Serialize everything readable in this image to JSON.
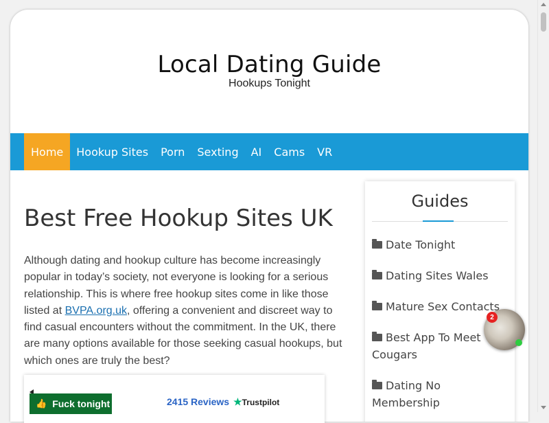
{
  "header": {
    "site_title": "Local Dating Guide",
    "tagline": "Hookups Tonight"
  },
  "nav": {
    "items": [
      {
        "label": "Home",
        "active": true
      },
      {
        "label": "Hookup Sites"
      },
      {
        "label": "Porn"
      },
      {
        "label": "Sexting"
      },
      {
        "label": "AI"
      },
      {
        "label": "Cams"
      },
      {
        "label": "VR"
      }
    ]
  },
  "article": {
    "title": "Best Free Hookup Sites UK",
    "para_before_link": "Although dating and hookup culture has become increasingly popular in today’s society, not everyone is looking for a serious relationship. This is where free hookup sites come in like those listed at ",
    "link_text": "BVPA.org.uk",
    "para_after_link": ", offering a convenient and discreet way to find casual encounters without the commitment. In the UK, there are many options available for those seeking casual hookups, but which ones are truly the best?"
  },
  "reviews": {
    "count_text": "2415 Reviews",
    "brand": "Trustpilot"
  },
  "sidebar": {
    "title": "Guides",
    "items": [
      {
        "label": "Date Tonight"
      },
      {
        "label": "Dating Sites Wales"
      },
      {
        "label": "Mature Sex Contacts"
      },
      {
        "label": "Best App To Meet Cougars"
      },
      {
        "label": "Dating No Membership"
      }
    ]
  },
  "cta": {
    "label": "Fuck tonight",
    "icon": "thumbs-up-icon"
  },
  "chat_bubble": {
    "badge_count": "2"
  },
  "colors": {
    "nav_bg": "#1a9ad6",
    "nav_active": "#f5a623",
    "cta_bg": "#0e6e2e",
    "link": "#1a6fb0"
  }
}
